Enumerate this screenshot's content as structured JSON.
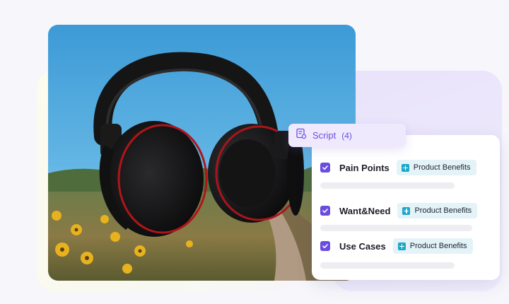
{
  "script_chip": {
    "label": "Script",
    "count": "(4)",
    "icon": "script-list-icon"
  },
  "card": {
    "rows": [
      {
        "label": "Pain Points",
        "checked": true,
        "tag": "Product Benefits"
      },
      {
        "label": "Want&Need",
        "checked": true,
        "tag": "Product Benefits"
      },
      {
        "label": "Use Cases",
        "checked": true,
        "tag": "Product Benefits"
      }
    ]
  },
  "colors": {
    "accent": "#6a4ce0",
    "tag_bg": "#e3f3f8",
    "tag_icon": "#1aa7c8",
    "chip_bg": "#eee9fd"
  }
}
